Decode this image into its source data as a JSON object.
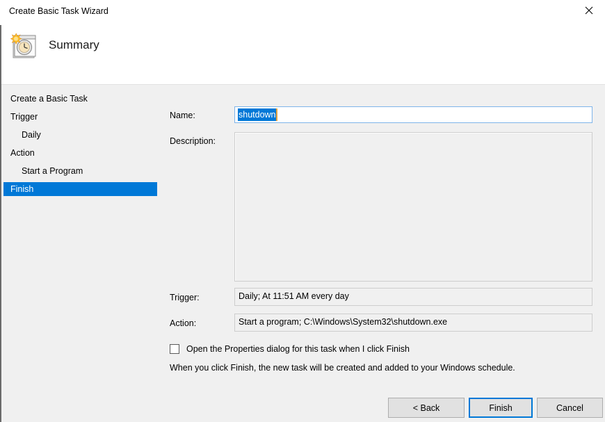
{
  "window": {
    "title": "Create Basic Task Wizard",
    "close_icon": "close-icon"
  },
  "header": {
    "icon": "task-scheduler-icon",
    "title": "Summary"
  },
  "sidebar": {
    "items": [
      {
        "label": "Create a Basic Task",
        "indent": false,
        "selected": false
      },
      {
        "label": "Trigger",
        "indent": false,
        "selected": false
      },
      {
        "label": "Daily",
        "indent": true,
        "selected": false
      },
      {
        "label": "Action",
        "indent": false,
        "selected": false
      },
      {
        "label": "Start a Program",
        "indent": true,
        "selected": false
      },
      {
        "label": "Finish",
        "indent": false,
        "selected": true
      }
    ]
  },
  "form": {
    "name_label": "Name:",
    "name_value": "shutdown",
    "name_selected": true,
    "description_label": "Description:",
    "description_value": "",
    "trigger_label": "Trigger:",
    "trigger_value": "Daily; At 11:51 AM every day",
    "action_label": "Action:",
    "action_value": "Start a program; C:\\Windows\\System32\\shutdown.exe",
    "checkbox_label": "Open the Properties dialog for this task when I click Finish",
    "checkbox_checked": false,
    "hint": "When you click Finish, the new task will be created and added to your Windows schedule."
  },
  "footer": {
    "back_label": "< Back",
    "finish_label": "Finish",
    "cancel_label": "Cancel"
  },
  "colors": {
    "accent": "#0078d7",
    "body_background": "#f0f0f0",
    "caret": "#e8a33d"
  }
}
